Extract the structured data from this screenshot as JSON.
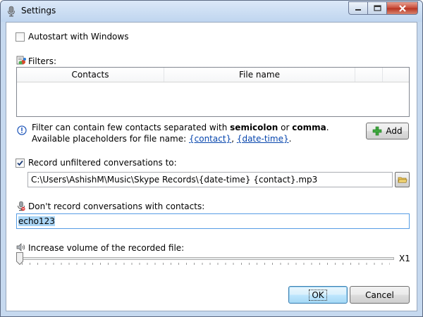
{
  "window": {
    "title": "Settings"
  },
  "autostart": {
    "label": "Autostart with Windows",
    "checked": false
  },
  "filters": {
    "label": "Filters:",
    "columns": [
      "Contacts",
      "File name"
    ],
    "rows": []
  },
  "info": {
    "line1_pre": "Filter can contain few contacts separated with ",
    "line1_bold1": "semicolon",
    "line1_mid": " or ",
    "line1_bold2": "comma",
    "line1_post": ".",
    "line2_pre": "Available placeholders for file name: ",
    "placeholder1": "{contact}",
    "sep": ", ",
    "placeholder2": "{date-time}",
    "line2_post": "."
  },
  "add_button": {
    "label": "Add"
  },
  "record_unfiltered": {
    "label": "Record unfiltered conversations to:",
    "checked": true,
    "path": "C:\\Users\\AshishM\\Music\\Skype Records\\{date-time} {contact}.mp3"
  },
  "exclude": {
    "label": "Don't record conversations with contacts:",
    "value": "echo123"
  },
  "volume": {
    "label": "Increase volume of the recorded file:",
    "level_text": "X1",
    "level": 0
  },
  "buttons": {
    "ok": "OK",
    "cancel": "Cancel"
  },
  "colors": {
    "link": "#0645ad",
    "selection": "#aad5f5",
    "accent": "#3c7fb1"
  }
}
